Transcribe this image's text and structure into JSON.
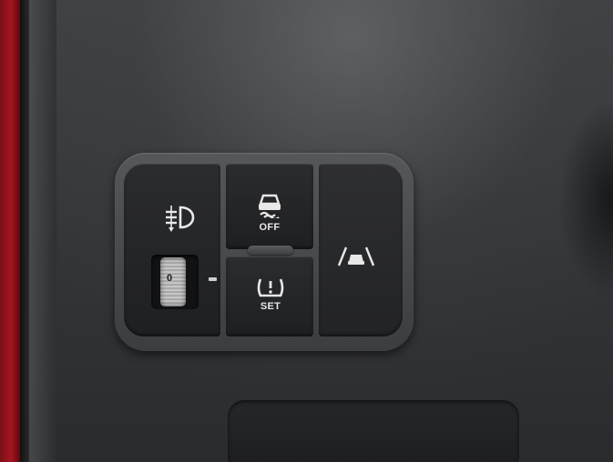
{
  "headlamp_wheel": {
    "indicator": "0"
  },
  "esc_button": {
    "label": "OFF",
    "icon": "traction-control-off-icon"
  },
  "tpms_button": {
    "label": "SET",
    "icon": "tire-pressure-icon"
  },
  "lane_button": {
    "icon": "lane-keeping-assist-icon"
  },
  "headlamp_button": {
    "icon": "headlamp-leveling-icon"
  },
  "colors": {
    "door_red": "#a5161f",
    "icon_white": "#e8e8e8",
    "panel_gray": "#3a3c3f"
  }
}
